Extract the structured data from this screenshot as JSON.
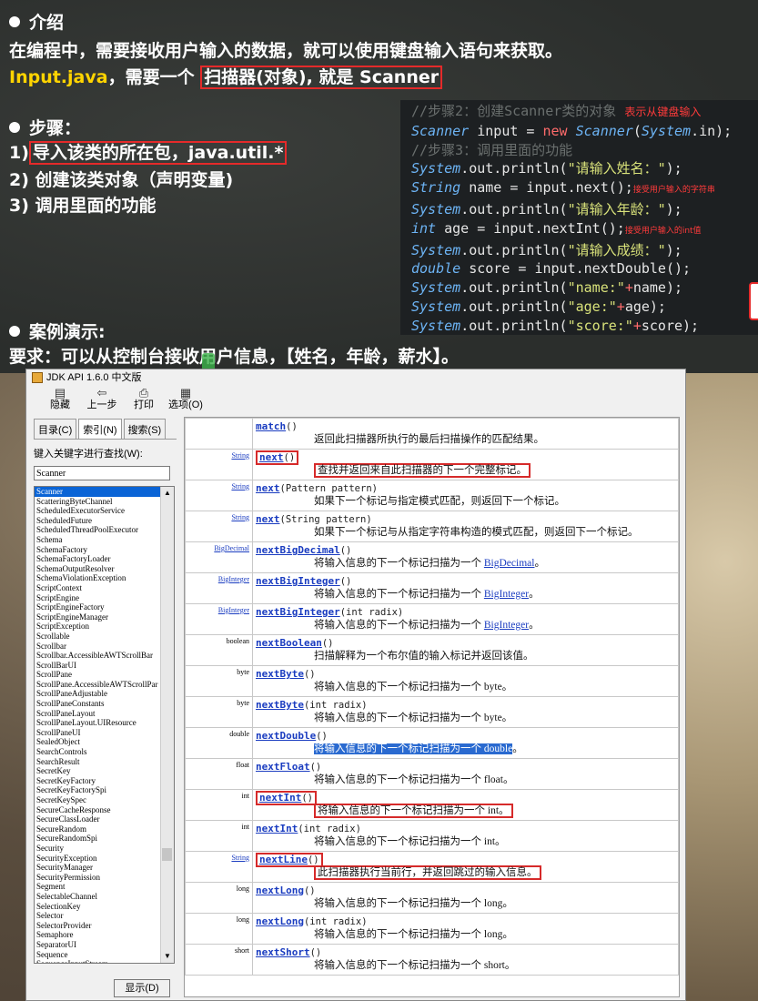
{
  "slide": {
    "intro_heading": "介绍",
    "intro_line": "在编程中，需要接收用户输入的数据，就可以使用键盘输入语句来获取。",
    "input_file": "Input.java",
    "input_rest": "，需要一个",
    "scanner_phrase": "扫描器(对象), 就是 Scanner",
    "steps_heading": "步骤：",
    "step1_num": "1)",
    "step1_text": "导入该类的所在包，java.util.*",
    "step2": "2) 创建该类对象（声明变量)",
    "step3": "3) 调用里面的功能",
    "demo_heading": "案例演示:",
    "demo_req": "要求：可以从控制台接收用户信息，【姓名，年龄，薪水】。"
  },
  "code": {
    "c1": "//步骤2：创建Scanner类的对象",
    "c1_note": "表示从键盘输入",
    "l1_type": "Scanner",
    "l1_var": " input  = ",
    "l1_new": "new",
    "l1_cls": "Scanner",
    "l1_paren": "(",
    "l1_sys": "System",
    "l1_tail": ".in);",
    "c2": "//步骤3：调用里面的功能",
    "p1_sys": "System",
    "p1_out": ".out.println(",
    "p1_str": "\"请输入姓名：\"",
    "p1_end": ");",
    "l2_type": "String",
    "l2_rest": " name = input.next();",
    "l2_note": "接受用户输入的字符串",
    "p2_str": "\"请输入年龄：\"",
    "l3_type": "int",
    "l3_rest": " age = input.nextInt();",
    "l3_note": "接受用户输入的int值",
    "p3_str": "\"请输入成绩：\"",
    "l4_type": "double",
    "l4_rest": " score = input.nextDouble();",
    "p4_str": "\"name:\"",
    "p4_plus": "+",
    "p4_var": "name);",
    "p5_str": "\"age:\"",
    "p5_var": "age);",
    "p6_str": "\"score:\"",
    "p6_var": "score);"
  },
  "window": {
    "title": "JDK API 1.6.0 中文版",
    "toolbar": [
      {
        "icon": "hide-icon",
        "glyph": "▤",
        "label": "隐藏"
      },
      {
        "icon": "back-icon",
        "glyph": "⇦",
        "label": "上一步"
      },
      {
        "icon": "print-icon",
        "glyph": "⎙",
        "label": "打印"
      },
      {
        "icon": "options-icon",
        "glyph": "▦",
        "label": "选项(O)"
      }
    ],
    "tabs": [
      "目录(C)",
      "索引(N)",
      "搜索(S)"
    ],
    "keyword_label": "键入关键字进行查找(W):",
    "search_value": "Scanner",
    "show_button": "显示(D)",
    "index_items": [
      "Scanner",
      "ScatteringByteChannel",
      "ScheduledExecutorService",
      "ScheduledFuture",
      "ScheduledThreadPoolExecutor",
      "Schema",
      "SchemaFactory",
      "SchemaFactoryLoader",
      "SchemaOutputResolver",
      "SchemaViolationException",
      "ScriptContext",
      "ScriptEngine",
      "ScriptEngineFactory",
      "ScriptEngineManager",
      "ScriptException",
      "Scrollable",
      "Scrollbar",
      "Scrollbar.AccessibleAWTScrollBar",
      "ScrollBarUI",
      "ScrollPane",
      "ScrollPane.AccessibleAWTScrollPar",
      "ScrollPaneAdjustable",
      "ScrollPaneConstants",
      "ScrollPaneLayout",
      "ScrollPaneLayout.UIResource",
      "ScrollPaneUI",
      "SealedObject",
      "SearchControls",
      "SearchResult",
      "SecretKey",
      "SecretKeyFactory",
      "SecretKeyFactorySpi",
      "SecretKeySpec",
      "SecureCacheResponse",
      "SecureClassLoader",
      "SecureRandom",
      "SecureRandomSpi",
      "Security",
      "SecurityException",
      "SecurityManager",
      "SecurityPermission",
      "Segment",
      "SelectableChannel",
      "SelectionKey",
      "Selector",
      "SelectorProvider",
      "Semaphore",
      "SeparatorUI",
      "Sequence",
      "SequenceInputStream"
    ]
  },
  "methods": [
    {
      "type": "",
      "name": "match",
      "params": "()",
      "desc": "返回此扫描器所执行的最后扫描操作的匹配结果。",
      "pre": "",
      "link": "",
      "post": ""
    },
    {
      "type": "String",
      "name": "next",
      "params": "()",
      "desc": "查找并返回来自此扫描器的下一个完整标记。",
      "pre": "",
      "link": "",
      "post": ""
    },
    {
      "type": "String",
      "name": "next",
      "params": "(Pattern pattern)",
      "desc": "如果下一个标记与指定模式匹配，则返回下一个标记。",
      "pre": "",
      "link": "",
      "post": ""
    },
    {
      "type": "String",
      "name": "next",
      "params": "(String pattern)",
      "desc": "如果下一个标记与从指定字符串构造的模式匹配，则返回下一个标记。",
      "pre": "",
      "link": "",
      "post": ""
    },
    {
      "type": "BigDecimal",
      "name": "nextBigDecimal",
      "params": "()",
      "desc": "",
      "pre": "将输入信息的下一个标记扫描为一个 ",
      "link": "BigDecimal",
      "post": "。"
    },
    {
      "type": "BigInteger",
      "name": "nextBigInteger",
      "params": "()",
      "desc": "",
      "pre": "将输入信息的下一个标记扫描为一个 ",
      "link": "BigInteger",
      "post": "。"
    },
    {
      "type": "BigInteger",
      "name": "nextBigInteger",
      "params": "(int radix)",
      "desc": "",
      "pre": "将输入信息的下一个标记扫描为一个 ",
      "link": "BigInteger",
      "post": "。"
    },
    {
      "type": "boolean",
      "name": "nextBoolean",
      "params": "()",
      "desc": "扫描解释为一个布尔值的输入标记并返回该值。",
      "pre": "",
      "link": "",
      "post": ""
    },
    {
      "type": "byte",
      "name": "nextByte",
      "params": "()",
      "desc": "将输入信息的下一个标记扫描为一个 byte。",
      "pre": "",
      "link": "",
      "post": ""
    },
    {
      "type": "byte",
      "name": "nextByte",
      "params": "(int radix)",
      "desc": "将输入信息的下一个标记扫描为一个 byte。",
      "pre": "",
      "link": "",
      "post": ""
    },
    {
      "type": "double",
      "name": "nextDouble",
      "params": "()",
      "desc": "将输入信息的下一个标记扫描为一个 double",
      "pre": "",
      "link": "",
      "post": "。"
    },
    {
      "type": "float",
      "name": "nextFloat",
      "params": "()",
      "desc": "将输入信息的下一个标记扫描为一个 float。",
      "pre": "",
      "link": "",
      "post": ""
    },
    {
      "type": "int",
      "name": "nextInt",
      "params": "()",
      "desc": "将输入信息的下一个标记扫描为一个 int。",
      "pre": "",
      "link": "",
      "post": ""
    },
    {
      "type": "int",
      "name": "nextInt",
      "params": "(int radix)",
      "desc": "将输入信息的下一个标记扫描为一个 int。",
      "pre": "",
      "link": "",
      "post": ""
    },
    {
      "type": "String",
      "name": "nextLine",
      "params": "()",
      "desc": "此扫描器执行当前行，并返回跳过的输入信息。",
      "pre": "",
      "link": "",
      "post": ""
    },
    {
      "type": "long",
      "name": "nextLong",
      "params": "()",
      "desc": "将输入信息的下一个标记扫描为一个 long。",
      "pre": "",
      "link": "",
      "post": ""
    },
    {
      "type": "long",
      "name": "nextLong",
      "params": "(int radix)",
      "desc": "将输入信息的下一个标记扫描为一个 long。",
      "pre": "",
      "link": "",
      "post": ""
    },
    {
      "type": "short",
      "name": "nextShort",
      "params": "()",
      "desc": "将输入信息的下一个标记扫描为一个 short。",
      "pre": "",
      "link": "",
      "post": ""
    }
  ]
}
